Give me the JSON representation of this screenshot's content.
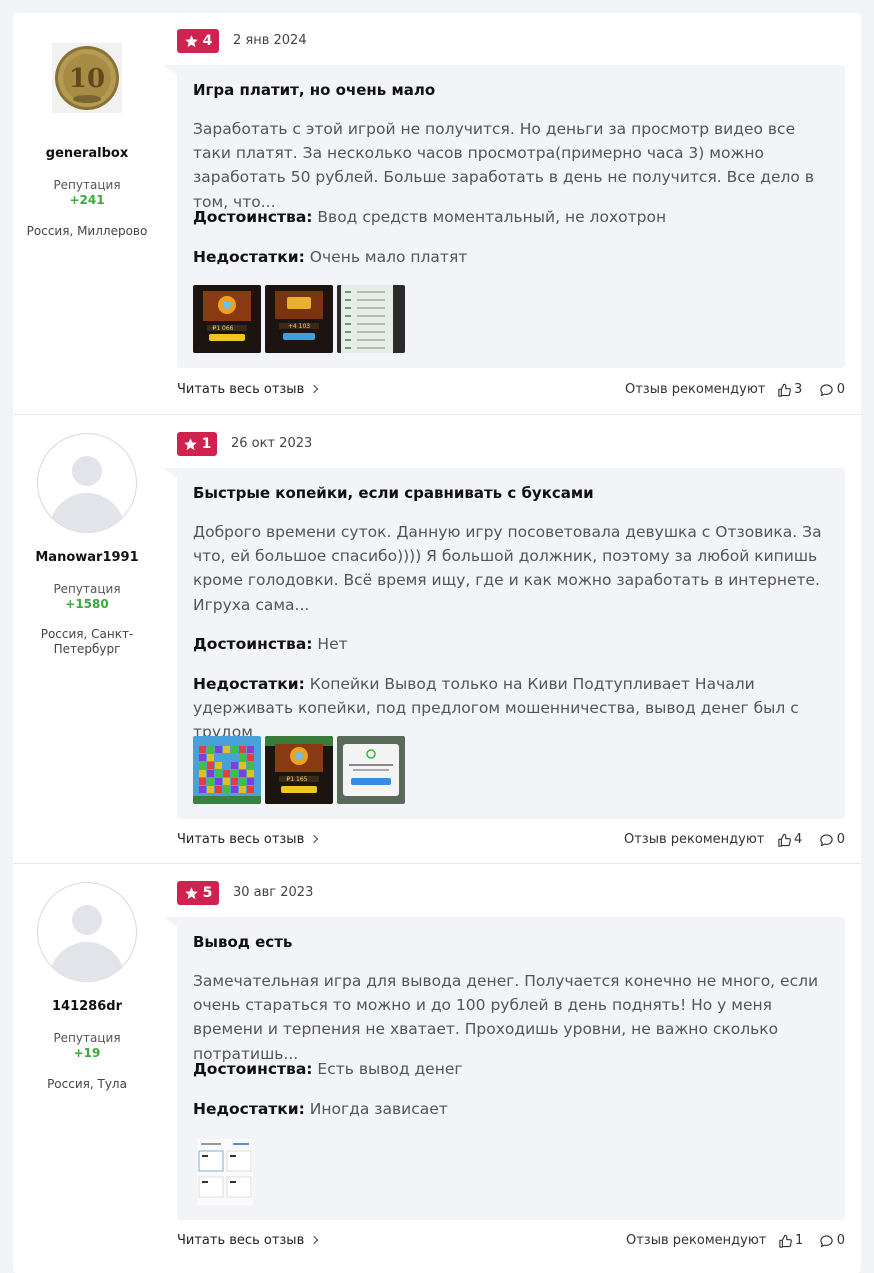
{
  "common": {
    "reputation_label": "Репутация",
    "read_more": "Читать весь отзыв",
    "recommend_label": "Отзыв рекомендуют",
    "pros_label": "Достоинства:",
    "cons_label": "Недостатки:"
  },
  "reviews": [
    {
      "author": "generalbox",
      "reputation": "+241",
      "location": "Россия, Миллерово",
      "rating": "4",
      "date": "2 янв 2024",
      "title": "Игра платит, но очень мало",
      "text": "Заработать с этой игрой не получится. Но деньги за просмотр видео все таки платят. За несколько часов просмотра(примерно часа 3) можно заработать 50 рублей. Больше заработать в день не получится. Все дело в том, что...",
      "pros": "Ввод средств моментальный, не лохотрон",
      "cons": "Очень мало платят",
      "likes": "3",
      "comments": "0"
    },
    {
      "author": "Manowar1991",
      "reputation": "+1580",
      "location": "Россия, Санкт-Петербург",
      "rating": "1",
      "date": "26 окт 2023",
      "title": "Быстрые копейки, если сравнивать с буксами",
      "text": "Доброго времени суток. Данную игру посоветовала девушка с Отзовика. За что, ей большое спасибо)))) Я большой должник, поэтому за любой кипишь кроме голодовки. Всё время ищу, где и как можно заработать в интернете. Игруха сама...",
      "pros": "Нет",
      "cons": "Копейки Вывод только на Киви Подтупливает Начали удерживать копейки, под предлогом мошенничества, вывод денег был с трудом",
      "likes": "4",
      "comments": "0"
    },
    {
      "author": "141286dr",
      "reputation": "+19",
      "location": "Россия, Тула",
      "rating": "5",
      "date": "30 авг 2023",
      "title": "Вывод есть",
      "text": "Замечательная игра для вывода денег. Получается конечно не много, если очень стараться то можно и до 100 рублей в день поднять! Но у меня времени и терпения не хватает. Проходишь уровни, не важно сколько потратишь...",
      "pros": "Есть вывод денег",
      "cons": "Иногда зависает",
      "likes": "1",
      "comments": "0"
    }
  ],
  "colors": {
    "rating_badge": "#d0224f",
    "reputation": "#3da83b",
    "card_bg": "#f3f4f7"
  }
}
